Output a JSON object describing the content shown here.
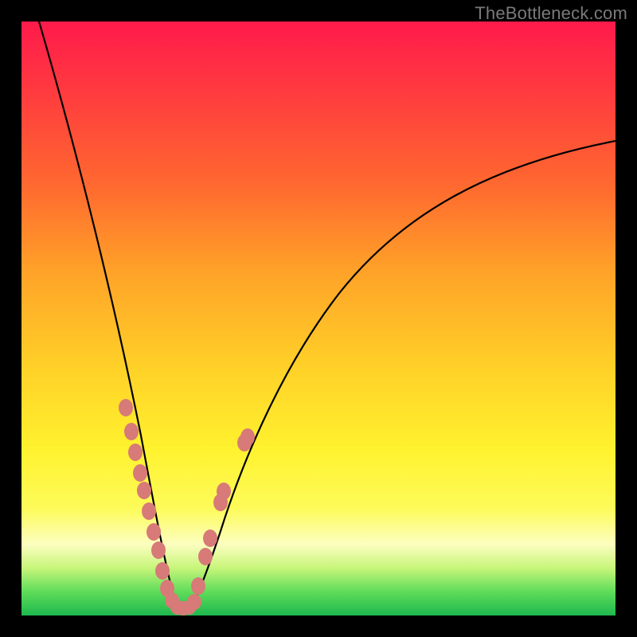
{
  "watermark": "TheBottleneck.com",
  "colors": {
    "frame": "#000000",
    "blob": "#d77a78",
    "curve": "#000000",
    "gradient_stops": [
      "#ff1a4b",
      "#ff3b3f",
      "#ff6a2f",
      "#ffa228",
      "#ffd028",
      "#fff22e",
      "#fdfb5a",
      "#fcfec0",
      "#c7f57a",
      "#5fdc5a",
      "#1db84e"
    ]
  },
  "chart_data": {
    "type": "line",
    "title": "",
    "xlabel": "",
    "ylabel": "",
    "xlim": [
      0,
      100
    ],
    "ylim": [
      0,
      100
    ],
    "grid": false,
    "legend": false,
    "note": "Two black curves forming a steep V; minimum (bottleneck optimum) near x≈26. Pink dot clusters mark sampled hardware points along both curve arms near the bottom. Values below are estimated pixel-positions mapped to a 0–100 range.",
    "series": [
      {
        "name": "left_curve",
        "x": [
          3,
          5,
          7,
          9,
          11,
          13,
          15,
          17,
          19,
          21,
          23,
          24,
          25,
          26
        ],
        "y": [
          100,
          91,
          82,
          73,
          64,
          55,
          46,
          37,
          28,
          19,
          10,
          6,
          3,
          1
        ]
      },
      {
        "name": "right_curve",
        "x": [
          27,
          28,
          30,
          33,
          37,
          42,
          48,
          55,
          63,
          72,
          82,
          92,
          100
        ],
        "y": [
          1,
          3,
          9,
          17,
          27,
          37,
          46,
          54,
          61,
          67,
          72,
          77,
          80
        ]
      }
    ],
    "markers": {
      "name": "sample_points",
      "color": "#d77a78",
      "points": [
        {
          "x": 17.5,
          "y": 35
        },
        {
          "x": 18.5,
          "y": 31
        },
        {
          "x": 19.2,
          "y": 27.5
        },
        {
          "x": 20.0,
          "y": 24
        },
        {
          "x": 20.7,
          "y": 21
        },
        {
          "x": 21.5,
          "y": 17.5
        },
        {
          "x": 22.3,
          "y": 14
        },
        {
          "x": 23.0,
          "y": 11
        },
        {
          "x": 23.8,
          "y": 7.5
        },
        {
          "x": 24.5,
          "y": 4.5
        },
        {
          "x": 25.3,
          "y": 2.5
        },
        {
          "x": 26.2,
          "y": 1.3
        },
        {
          "x": 27.2,
          "y": 1.2
        },
        {
          "x": 28.2,
          "y": 1.3
        },
        {
          "x": 29.0,
          "y": 2.2
        },
        {
          "x": 29.8,
          "y": 5
        },
        {
          "x": 31.0,
          "y": 10
        },
        {
          "x": 31.8,
          "y": 13
        },
        {
          "x": 33.5,
          "y": 19
        },
        {
          "x": 34.0,
          "y": 21
        },
        {
          "x": 37.5,
          "y": 29
        },
        {
          "x": 38.0,
          "y": 30
        }
      ]
    }
  }
}
